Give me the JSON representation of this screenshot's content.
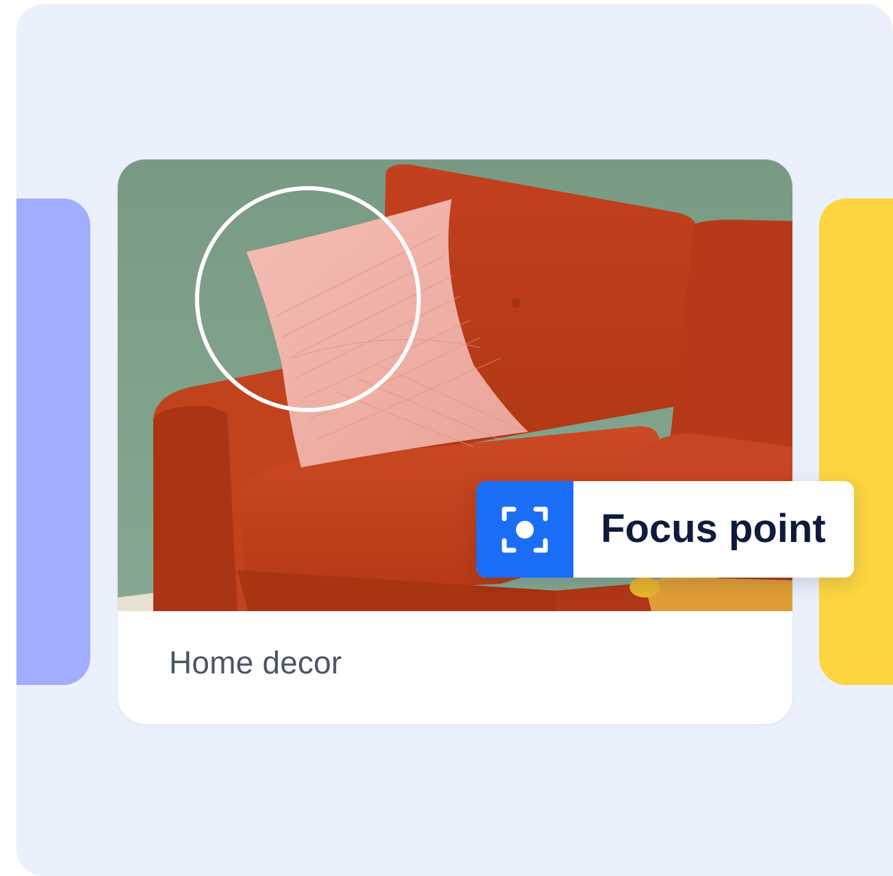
{
  "card": {
    "caption": "Home decor",
    "image_alt": "Orange sofa with a pink quilted pillow"
  },
  "focus_chip": {
    "label": "Focus point",
    "icon": "focus-point-icon"
  },
  "colors": {
    "background": "#EAF0FC",
    "left_card": "#A1AEFF",
    "right_card": "#FCD541",
    "accent_blue": "#1A6DF5",
    "sofa": "#C9441E",
    "wall": "#7A9D84",
    "pillow": "#F0B0A6",
    "caption_text": "#4A5566",
    "chip_text": "#0E1B3D"
  }
}
